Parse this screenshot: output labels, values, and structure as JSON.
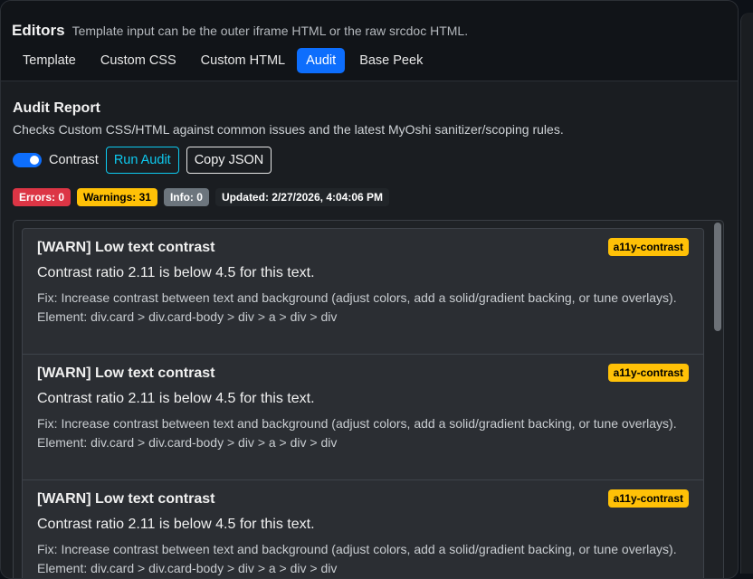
{
  "header": {
    "title": "Editors",
    "subtitle": "Template input can be the outer iframe HTML or the raw srcdoc HTML."
  },
  "tabs": [
    {
      "label": "Template",
      "active": false
    },
    {
      "label": "Custom CSS",
      "active": false
    },
    {
      "label": "Custom HTML",
      "active": false
    },
    {
      "label": "Audit",
      "active": true
    },
    {
      "label": "Base Peek",
      "active": false
    }
  ],
  "audit": {
    "title": "Audit Report",
    "description": "Checks Custom CSS/HTML against common issues and the latest MyOshi sanitizer/scoping rules.",
    "contrast_toggle": {
      "label": "Contrast",
      "checked": true
    },
    "run_button": "Run Audit",
    "copy_button": "Copy JSON",
    "badges": {
      "errors": "Errors: 0",
      "warnings": "Warnings: 31",
      "info": "Info: 0",
      "updated": "Updated: 2/27/2026, 4:04:06 PM"
    },
    "items": [
      {
        "title": "[WARN] Low text contrast",
        "tag": "a11y-contrast",
        "message": "Contrast ratio 2.11 is below 4.5 for this text.",
        "fix": "Fix: Increase contrast between text and background (adjust colors, add a solid/gradient backing, or tune overlays).",
        "element": "Element: div.card > div.card-body > div > a > div > div"
      },
      {
        "title": "[WARN] Low text contrast",
        "tag": "a11y-contrast",
        "message": "Contrast ratio 2.11 is below 4.5 for this text.",
        "fix": "Fix: Increase contrast between text and background (adjust colors, add a solid/gradient backing, or tune overlays).",
        "element": "Element: div.card > div.card-body > div > a > div > div"
      },
      {
        "title": "[WARN] Low text contrast",
        "tag": "a11y-contrast",
        "message": "Contrast ratio 2.11 is below 4.5 for this text.",
        "fix": "Fix: Increase contrast between text and background (adjust colors, add a solid/gradient backing, or tune overlays).",
        "element": "Element: div.card > div.card-body > div > a > div > div"
      }
    ]
  },
  "colors": {
    "accent": "#0d6efd",
    "info_button": "#0dcaf0",
    "danger": "#dc3545",
    "warning": "#ffc107",
    "secondary": "#6c757d"
  }
}
